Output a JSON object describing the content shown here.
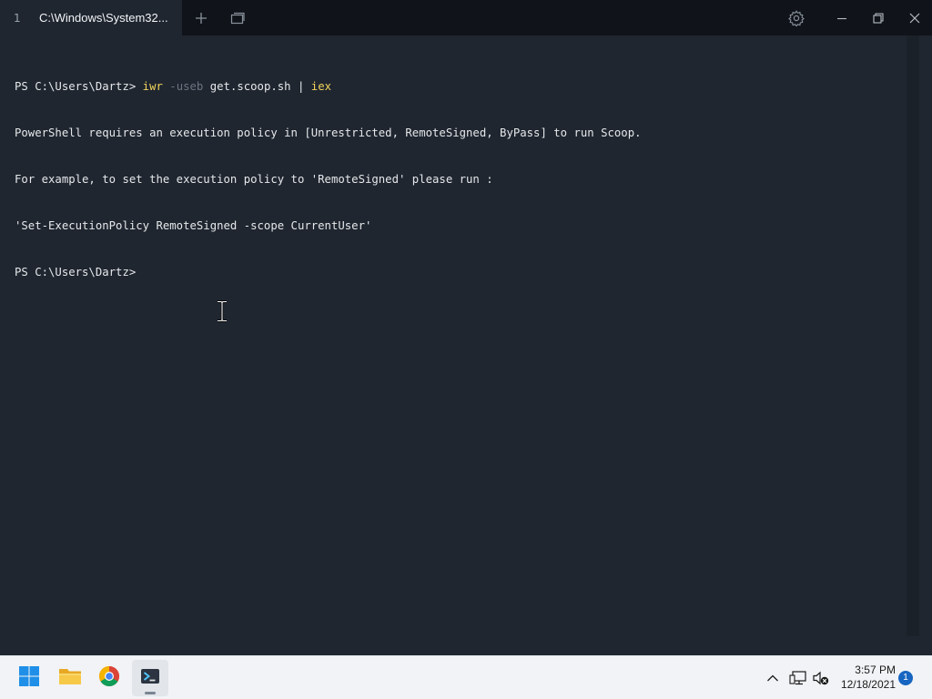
{
  "tab": {
    "index": "1",
    "title": "C:\\Windows\\System32..."
  },
  "terminal": {
    "lines": [
      {
        "prompt": "PS C:\\Users\\Dartz> ",
        "cmd": "iwr",
        "param": "-useb",
        "arg": "get.scoop.sh | ",
        "pipe_cmd": "iex"
      },
      {
        "text": "PowerShell requires an execution policy in [Unrestricted, RemoteSigned, ByPass] to run Scoop."
      },
      {
        "text": "For example, to set the execution policy to 'RemoteSigned' please run :"
      },
      {
        "text": "'Set-ExecutionPolicy RemoteSigned -scope CurrentUser'"
      },
      {
        "text": "PS C:\\Users\\Dartz>"
      }
    ]
  },
  "icons": {
    "new_tab": "plus-icon",
    "tab_dropdown": "tab-switcher-icon",
    "settings": "gear-icon",
    "minimize": "minimize-icon",
    "restore": "restore-icon",
    "close": "close-icon"
  },
  "taskbar": {
    "apps": [
      "start-icon",
      "file-explorer-icon",
      "chrome-icon",
      "terminal-icon"
    ],
    "tray": [
      "chevron-up-icon",
      "network-icon",
      "volume-muted-icon"
    ],
    "time": "3:57 PM",
    "date": "12/18/2021",
    "notification_count": "1"
  },
  "colors": {
    "terminal_bg": "#1f2630",
    "titlebar_bg": "#10141a",
    "command_yellow": "#f2d35a",
    "param_gray": "#6c7480",
    "taskbar_bg": "#f1f3f6",
    "badge_blue": "#1765c1"
  }
}
